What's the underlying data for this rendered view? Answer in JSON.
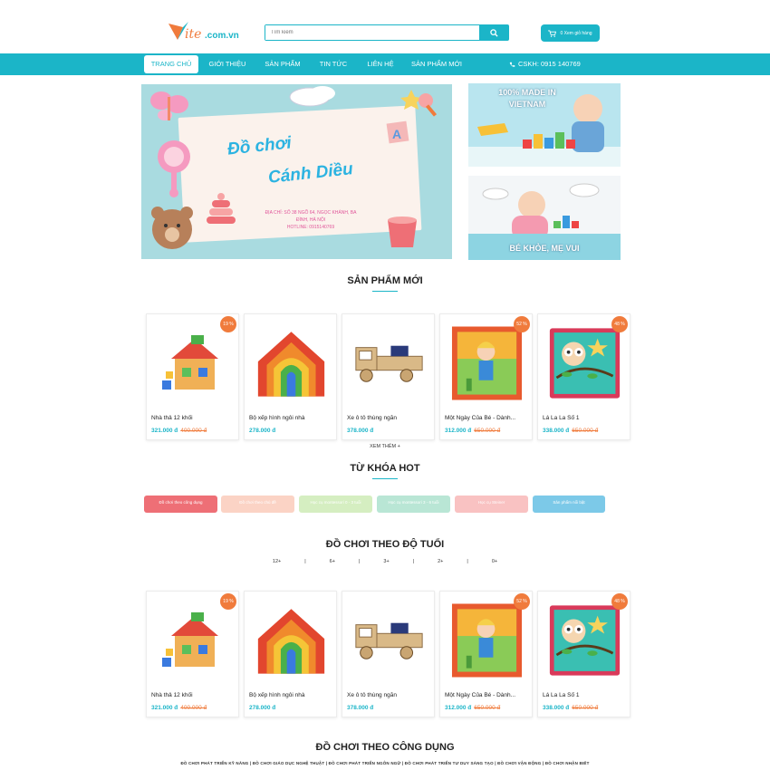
{
  "header": {
    "search_placeholder": "Tìm kiếm",
    "cart_label": "0 Xem giỏ hàng"
  },
  "nav": {
    "items": [
      "TRANG CHỦ",
      "GIỚI THIỆU",
      "SẢN PHẨM",
      "TIN TỨC",
      "LIÊN HỆ",
      "SẢN PHẨM MỚI"
    ],
    "phone": "CSKH: 0915 140769"
  },
  "banner": {
    "title_line1": "Đồ chơi",
    "title_line2": "Cánh Diều",
    "address": "ĐỊA CHỈ: SỐ 38 NGÕ 64, NGỌC KHÁNH, BA ĐÌNH, HÀ NỘI",
    "hotline": "HOTLINE: 0915140769",
    "side1": "100% MADE IN VIETNAM",
    "side2": "BÉ KHỎE, MẸ VUI"
  },
  "sections": {
    "new_products": "SẢN PHẨM MỚI",
    "see_more": "XEM THÊM +",
    "hot_keywords": "TỪ KHÓA HOT",
    "by_age": "ĐỒ CHƠI THEO ĐỘ TUỔI",
    "by_usage": "ĐỒ CHƠI THEO CÔNG DỤNG"
  },
  "products": [
    {
      "name": "Nhà thả 12 khối",
      "price": "321.000 đ",
      "old_price": "400.000 đ",
      "badge": "19 %",
      "icon": "house-toy-icon"
    },
    {
      "name": "Bộ xếp hình ngôi nhà",
      "price": "278.000 đ",
      "old_price": "",
      "badge": "",
      "icon": "rainbow-stacker-icon"
    },
    {
      "name": "Xe ô tô thùng ngắn",
      "price": "378.000 đ",
      "old_price": "",
      "badge": "",
      "icon": "wooden-truck-icon"
    },
    {
      "name": "Một Ngày Của Bé - Dành...",
      "price": "312.000 đ",
      "old_price": "650.000 đ",
      "badge": "52 %",
      "icon": "cloth-book-girl-icon"
    },
    {
      "name": "Lá La La Số 1",
      "price": "338.000 đ",
      "old_price": "650.000 đ",
      "badge": "48 %",
      "icon": "cloth-book-owl-icon"
    }
  ],
  "hot_tags": [
    {
      "label": "Đồ chơi theo công dụng",
      "color": "#ee6f76"
    },
    {
      "label": "Đồ chơi theo chủ đề",
      "color": "#fbd3c5"
    },
    {
      "label": "Học cụ montessori 0 - 3 tuổi",
      "color": "#d5eec1"
    },
    {
      "label": "Học cụ montessori 3 - 6 tuổi",
      "color": "#b9e6d5"
    },
    {
      "label": "Học cụ Steiner",
      "color": "#f9c2c2"
    },
    {
      "label": "Sản phẩm nổi bật",
      "color": "#7cc9e8"
    }
  ],
  "ages": [
    "12+",
    "|",
    "6+",
    "|",
    "3+",
    "|",
    "2+",
    "|",
    "0+"
  ],
  "usage_links": "ĐỒ CHƠI PHÁT TRIỂN KỸ NĂNG | ĐỒ CHƠI GIÁO DỤC NGHỆ THUẬT | ĐỒ CHƠI PHÁT TRIỂN NGÔN NGỮ | ĐỒ CHƠI PHÁT TRIỂN TƯ DUY SÁNG TẠO | ĐỒ CHƠI VẬN ĐỘNG | ĐỒ CHƠI NHẬN BIẾT",
  "colors": {
    "accent": "#1bb5c8",
    "sale": "#f07b3c"
  }
}
